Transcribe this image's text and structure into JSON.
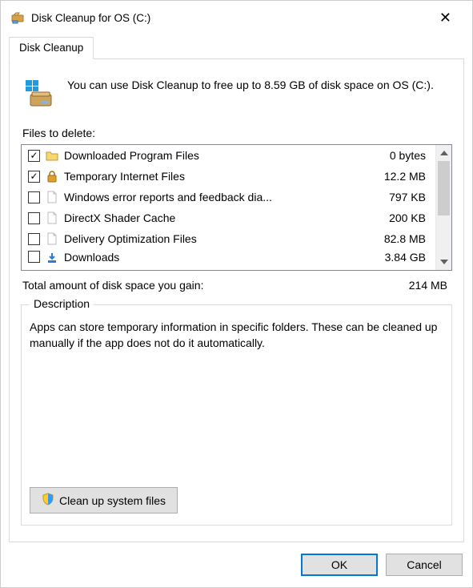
{
  "titlebar": {
    "title": "Disk Cleanup for OS (C:)"
  },
  "tab": {
    "label": "Disk Cleanup"
  },
  "intro": {
    "text": "You can use Disk Cleanup to free up to 8.59 GB of disk space on OS (C:)."
  },
  "section": {
    "files_to_delete": "Files to delete:"
  },
  "files": [
    {
      "checked": true,
      "icon": "folder",
      "name": "Downloaded Program Files",
      "size": "0 bytes"
    },
    {
      "checked": true,
      "icon": "lock",
      "name": "Temporary Internet Files",
      "size": "12.2 MB"
    },
    {
      "checked": false,
      "icon": "file",
      "name": "Windows error reports and feedback dia...",
      "size": "797 KB"
    },
    {
      "checked": false,
      "icon": "file",
      "name": "DirectX Shader Cache",
      "size": "200 KB"
    },
    {
      "checked": false,
      "icon": "file",
      "name": "Delivery Optimization Files",
      "size": "82.8 MB"
    },
    {
      "checked": false,
      "icon": "download",
      "name": "Downloads",
      "size": "3.84 GB"
    }
  ],
  "total": {
    "label": "Total amount of disk space you gain:",
    "value": "214 MB"
  },
  "description": {
    "legend": "Description",
    "text": "Apps can store temporary information in specific folders. These can be cleaned up manually if the app does not do it automatically."
  },
  "cleanup_button": "Clean up system files",
  "buttons": {
    "ok": "OK",
    "cancel": "Cancel"
  }
}
